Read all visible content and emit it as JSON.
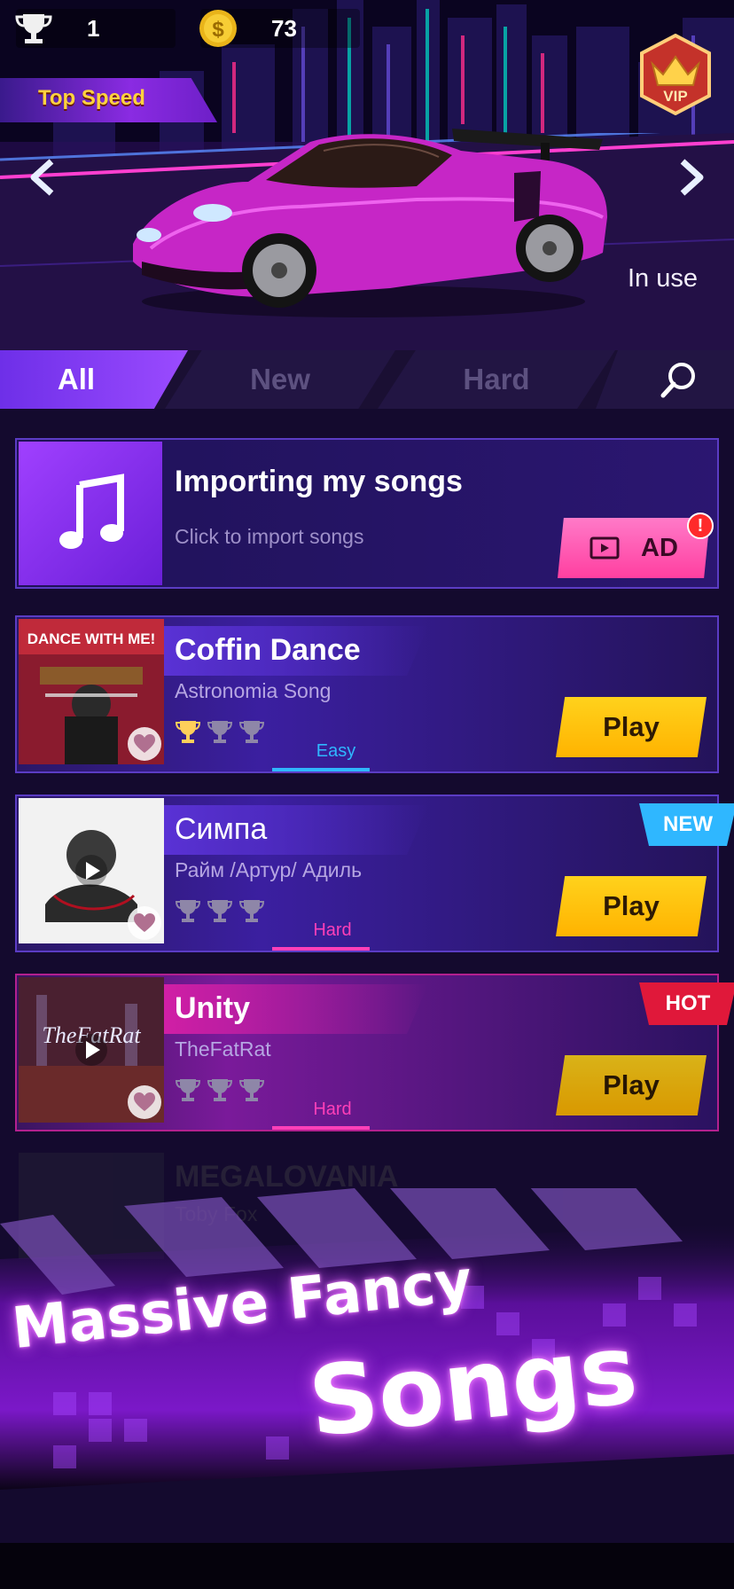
{
  "header": {
    "trophy_count": "1",
    "coin_count": "73",
    "badge_label": "Top Speed",
    "vip_label": "VIP",
    "car_status": "In use"
  },
  "tabs": {
    "all": "All",
    "new": "New",
    "hard": "Hard"
  },
  "import_card": {
    "title": "Importing my songs",
    "subtitle": "Click to import songs",
    "button": "AD",
    "alert": "!"
  },
  "songs": [
    {
      "title": "Coffin Dance",
      "artist": "Astronomia Song",
      "difficulty": "Easy",
      "difficulty_color": "#2fb7ff",
      "trophies_earned": 1,
      "badge": "",
      "play": "Play",
      "thumb_text": "DANCE WITH ME!"
    },
    {
      "title": "Симпа",
      "artist": "Райм /Артур/ Адиль",
      "difficulty": "Hard",
      "difficulty_color": "#ff3fb8",
      "trophies_earned": 0,
      "badge": "NEW",
      "play": "Play"
    },
    {
      "title": "Unity",
      "artist": "TheFatRat",
      "difficulty": "Hard",
      "difficulty_color": "#ff3fb8",
      "trophies_earned": 0,
      "badge": "HOT",
      "play": "Play",
      "thumb_text": "TheFatRat"
    },
    {
      "title": "MEGALOVANIA",
      "artist": "Toby Fox"
    }
  ],
  "promo": {
    "line1": "Massive Fancy",
    "line2": "Songs"
  },
  "colors": {
    "accent_purple": "#8a2be2",
    "play_yellow": "#ffc107",
    "ad_pink": "#ff5fb4",
    "new_blue": "#2fb7ff",
    "hot_red": "#e0183a"
  }
}
